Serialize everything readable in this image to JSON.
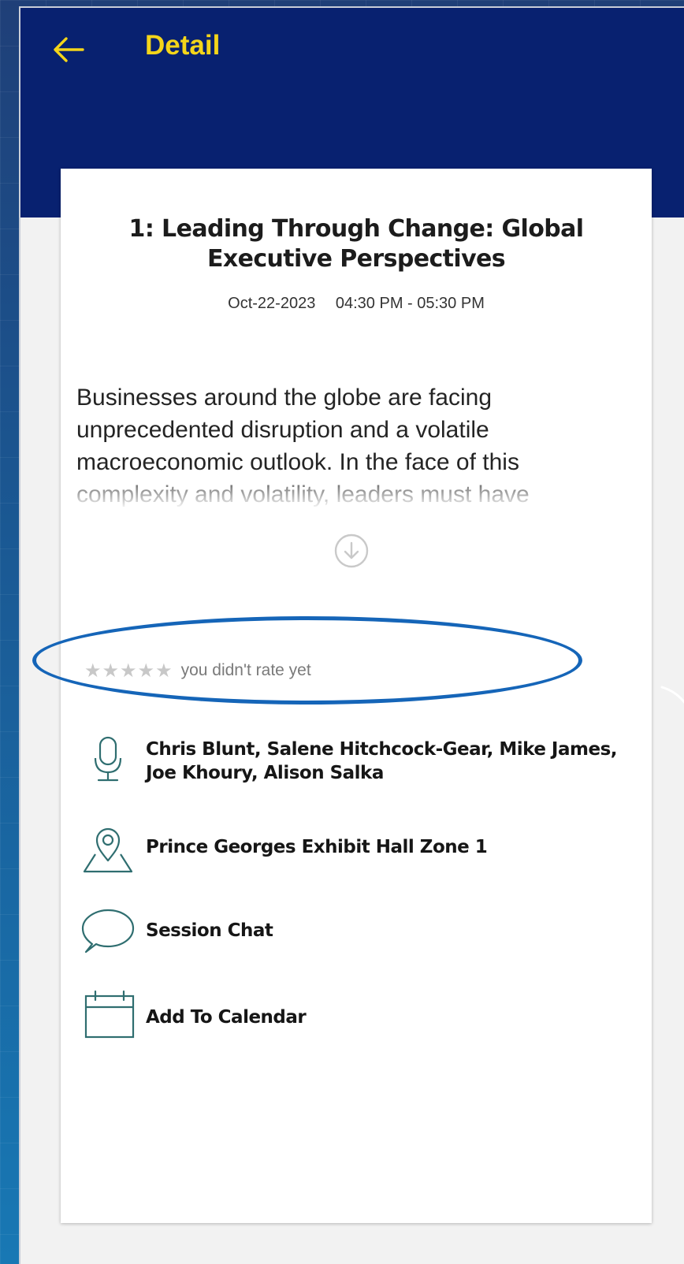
{
  "appbar": {
    "back_icon": "arrow-left-icon",
    "title": "Detail",
    "accent_color": "#f4d51a",
    "bar_color": "#082170"
  },
  "session": {
    "title": "1: Leading Through Change: Global Executive Perspectives",
    "date": "Oct-22-2023",
    "time": "04:30 PM - 05:30 PM",
    "description": "Businesses around the globe are facing unprecedented disruption and a volatile macroeconomic outlook. In the face of this complexity and volatility, leaders must have",
    "expand_icon": "chevron-down-circle-icon"
  },
  "rating": {
    "stars_total": 5,
    "stars_filled": 0,
    "text": "you didn't rate yet",
    "highlight_color": "#1565b8"
  },
  "details": {
    "speakers_icon": "microphone-icon",
    "speakers": "Chris Blunt, Salene Hitchcock-Gear, Mike James, Joe Khoury, Alison Salka",
    "location_icon": "map-pin-icon",
    "location": "Prince Georges Exhibit Hall Zone 1",
    "chat_icon": "chat-bubble-icon",
    "chat": "Session Chat",
    "calendar_icon": "calendar-icon",
    "calendar": "Add To Calendar",
    "icon_color": "#2f6e70"
  }
}
